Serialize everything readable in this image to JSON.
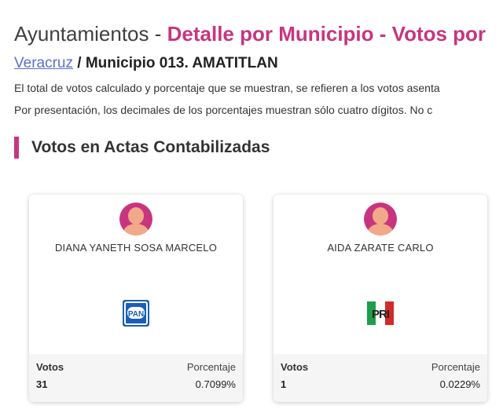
{
  "header": {
    "title_prefix": "Ayuntamientos - ",
    "title_accent": "Detalle por Municipio",
    "title_suffix": " - Votos por"
  },
  "breadcrumb": {
    "state_link": "Veracruz",
    "separator": " / ",
    "municipality": "Municipio 013. AMATITLAN"
  },
  "notes": [
    "El total de votos calculado y porcentaje que se muestran, se refieren a los votos asenta",
    "Por presentación, los decimales de los porcentajes muestran sólo cuatro dígitos. No c"
  ],
  "section": {
    "title": "Votos en Actas Contabilizadas"
  },
  "cards": [
    {
      "candidate": "DIANA YANETH SOSA MARCELO",
      "party_icon": "pan-logo-icon",
      "party_text": "PAN",
      "votes_label": "Votos",
      "percent_label": "Porcentaje",
      "votes": "31",
      "percent": "0.7099%"
    },
    {
      "candidate": "AIDA ZARATE CARLO",
      "party_icon": "pri-logo-icon",
      "party_text": "PRI",
      "votes_label": "Votos",
      "percent_label": "Porcentaje",
      "votes": "1",
      "percent": "0.0229%"
    }
  ],
  "colors": {
    "accent": "#c8357f",
    "link": "#5a6fd1",
    "pan_blue": "#1a5fb4",
    "pri_green": "#1e9e4a",
    "pri_red": "#d22a2a"
  }
}
